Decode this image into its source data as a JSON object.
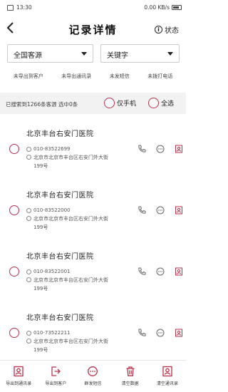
{
  "status_bar": {
    "time": "13:30",
    "right": "0.00 KB/s"
  },
  "header": {
    "title": "记录详情",
    "status_label": "状态"
  },
  "filters": {
    "source": "全国客源",
    "keyword": "关键字"
  },
  "chips": [
    "未导出到客户",
    "未导出通讯录",
    "未发短信",
    "未拨打电话"
  ],
  "summary": {
    "text": "已搜索到1266条客源 选中0条",
    "options": [
      "仅手机",
      "全选"
    ]
  },
  "records": [
    {
      "name": "北京丰台右安门医院",
      "phone": "010-83522699",
      "address": "北京市北京市丰台区右安门外大街199号"
    },
    {
      "name": "北京丰台右安门医院",
      "phone": "010-83522000",
      "address": "北京市北京市丰台区右安门外大街199号"
    },
    {
      "name": "北京丰台右安门医院",
      "phone": "010-83522001",
      "address": "北京市北京市丰台区右安门外大街199号"
    },
    {
      "name": "北京丰台右安门医院",
      "phone": "010-73522211",
      "address": "北京市北京市丰台区右安门外大街199号"
    }
  ],
  "bottom_bar": [
    {
      "label": "导出到通讯录",
      "icon": "contacts-icon"
    },
    {
      "label": "导出到客户",
      "icon": "export-icon"
    },
    {
      "label": "群发短信",
      "icon": "sms-icon"
    },
    {
      "label": "清空数据",
      "icon": "trash-icon"
    },
    {
      "label": "清空通讯录",
      "icon": "clear-contacts-icon"
    }
  ],
  "colors": {
    "accent": "#b8304a"
  }
}
